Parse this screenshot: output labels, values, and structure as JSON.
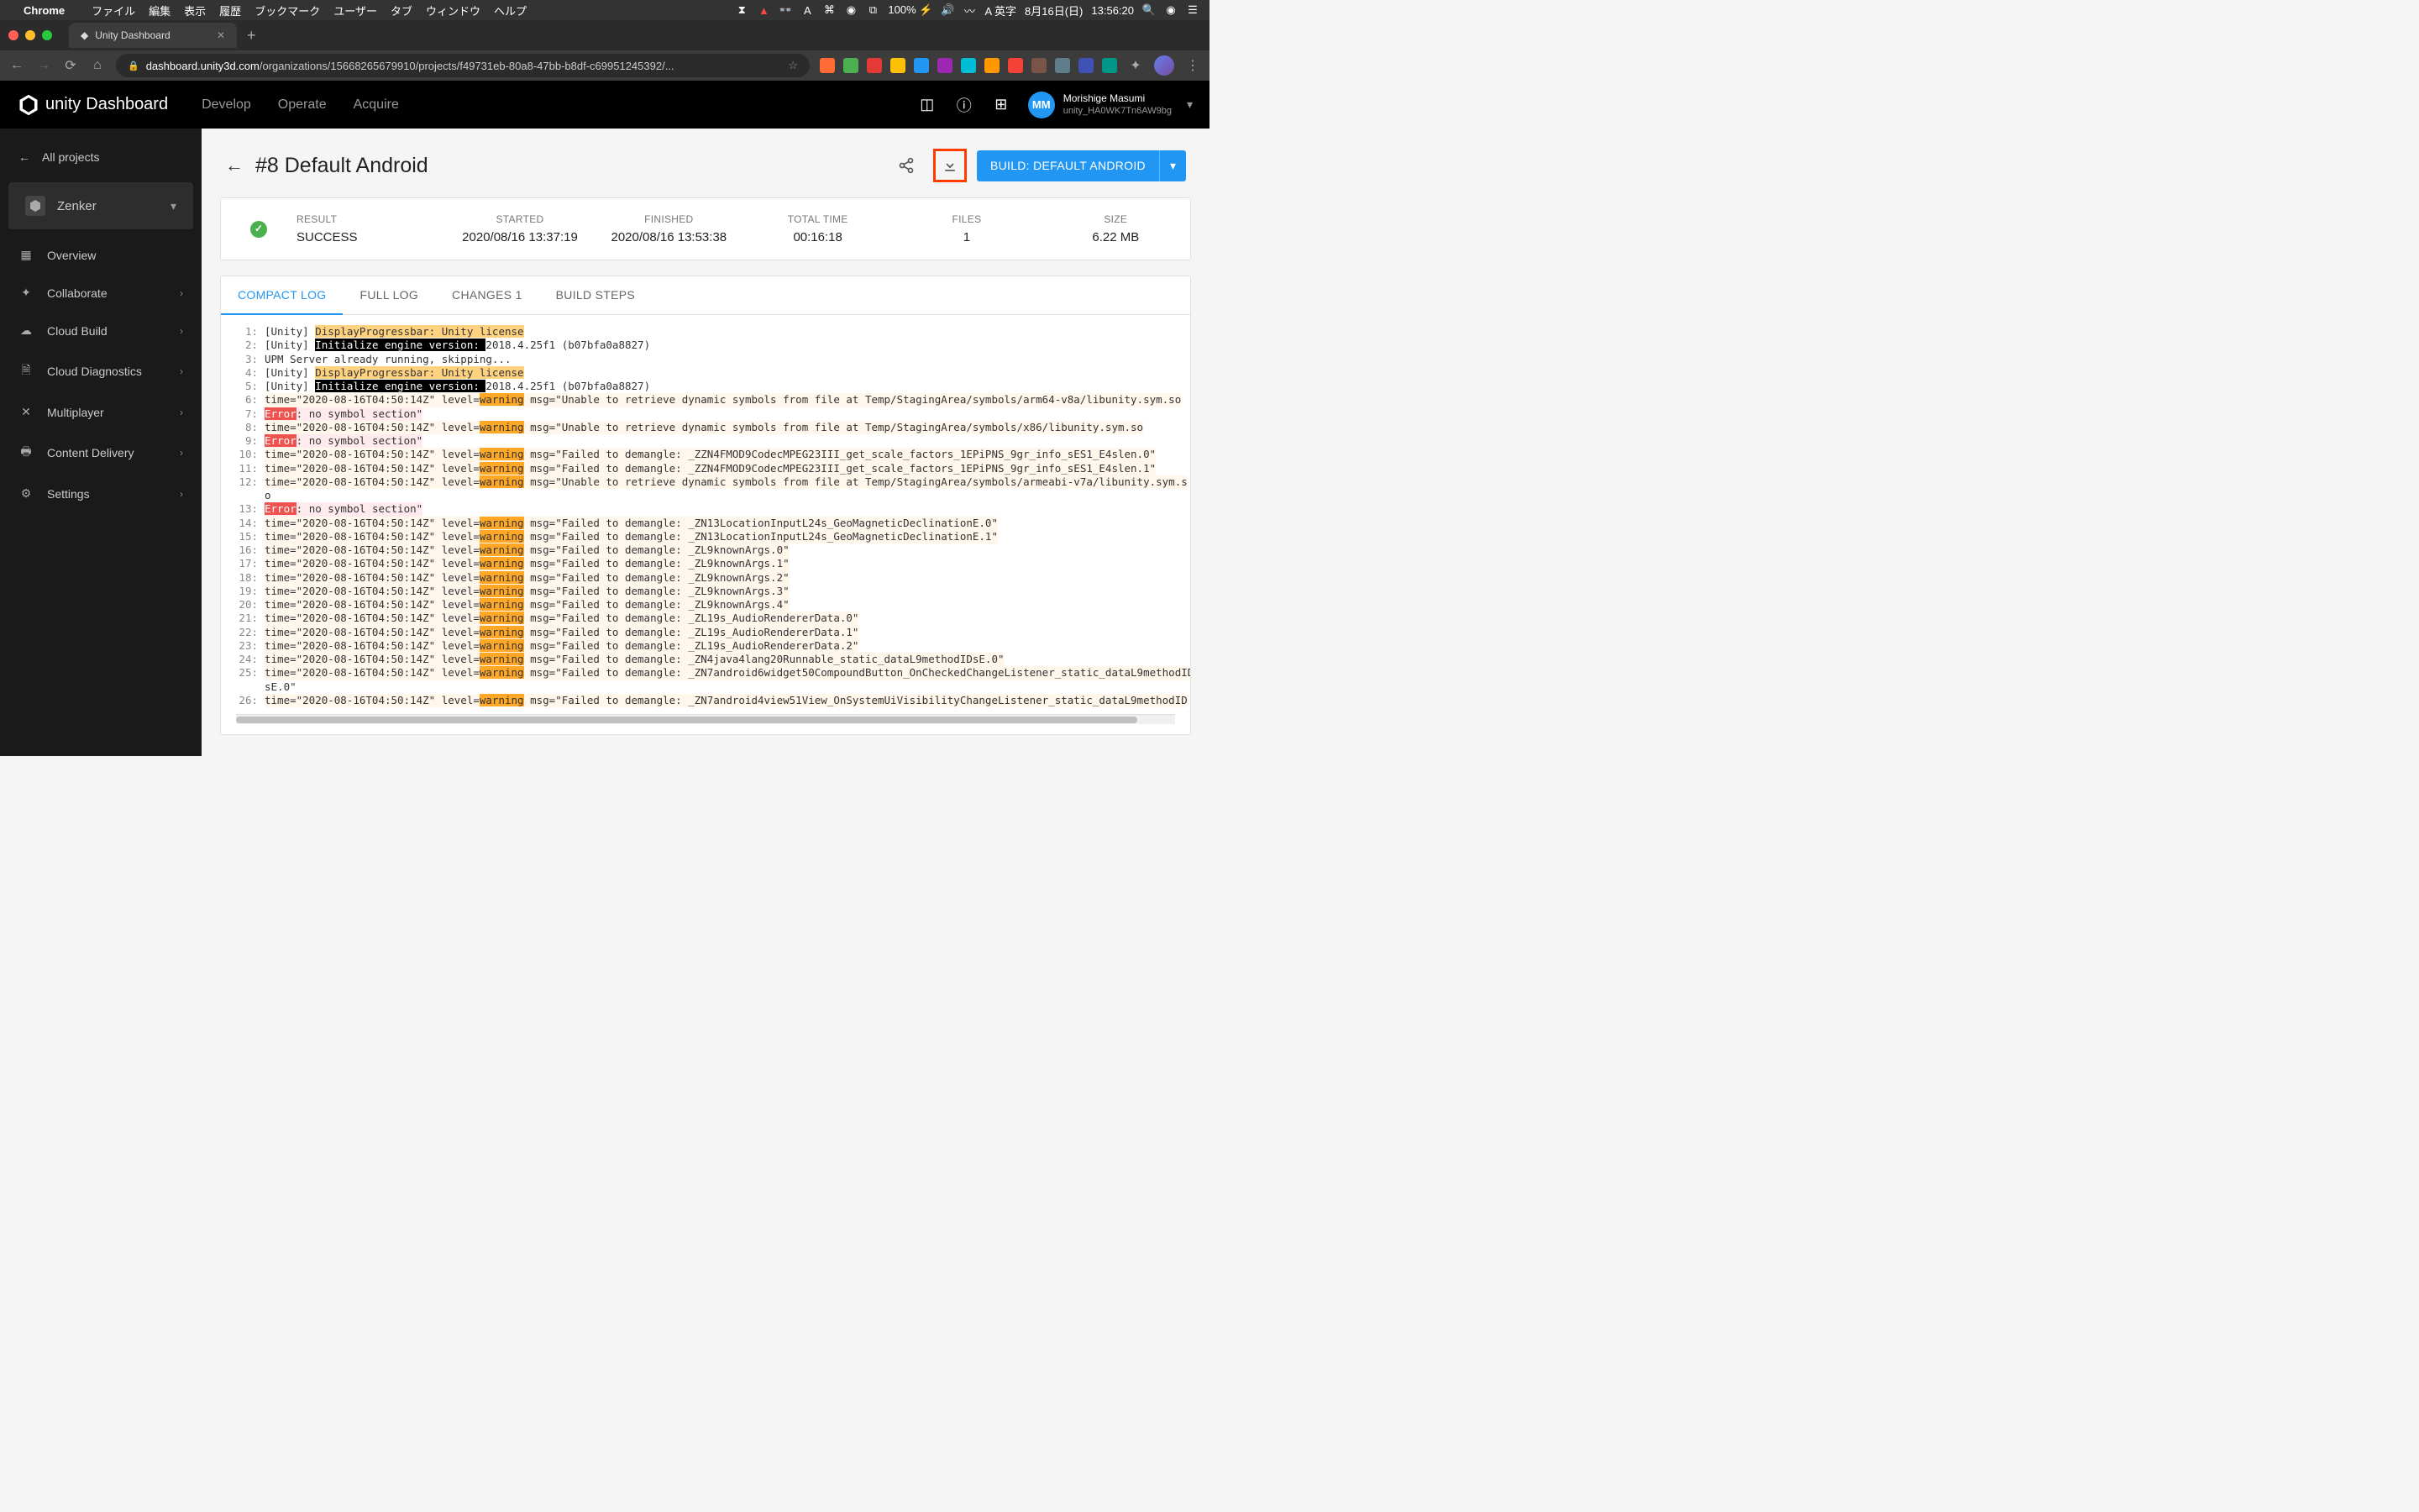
{
  "menubar": {
    "app": "Chrome",
    "items": [
      "ファイル",
      "編集",
      "表示",
      "履歴",
      "ブックマーク",
      "ユーザー",
      "タブ",
      "ウィンドウ",
      "ヘルプ"
    ],
    "battery": "100%",
    "ime": "英字",
    "date": "8月16日(日)",
    "time": "13:56:20"
  },
  "browser": {
    "tab_title": "Unity Dashboard",
    "url_host": "dashboard.unity3d.com",
    "url_path": "/organizations/15668265679910/projects/f49731eb-80a8-47bb-b8df-c69951245392/..."
  },
  "header": {
    "brand": "Dashboard",
    "nav": {
      "develop": "Develop",
      "operate": "Operate",
      "acquire": "Acquire"
    },
    "user": {
      "initials": "MM",
      "name": "Morishige Masumi",
      "org": "unity_HA0WK7Tn6AW9bg"
    }
  },
  "sidebar": {
    "back": "All projects",
    "project": "Zenker",
    "items": [
      {
        "icon": "▦",
        "label": "Overview",
        "chevron": false
      },
      {
        "icon": "✦",
        "label": "Collaborate",
        "chevron": true
      },
      {
        "icon": "☁",
        "label": "Cloud Build",
        "chevron": true
      },
      {
        "icon": "🗎",
        "label": "Cloud Diagnostics",
        "chevron": true
      },
      {
        "icon": "✕",
        "label": "Multiplayer",
        "chevron": true
      },
      {
        "icon": "🖶",
        "label": "Content Delivery",
        "chevron": true
      },
      {
        "icon": "⚙",
        "label": "Settings",
        "chevron": true
      }
    ]
  },
  "page": {
    "title": "#8 Default Android",
    "build_button": "BUILD: DEFAULT ANDROID"
  },
  "summary": {
    "labels": {
      "result": "RESULT",
      "started": "STARTED",
      "finished": "FINISHED",
      "total_time": "TOTAL TIME",
      "files": "FILES",
      "size": "SIZE"
    },
    "values": {
      "result": "SUCCESS",
      "started": "2020/08/16 13:37:19",
      "finished": "2020/08/16 13:53:38",
      "total_time": "00:16:18",
      "files": "1",
      "size": "6.22 MB"
    }
  },
  "log_tabs": {
    "compact": "COMPACT LOG",
    "full": "FULL LOG",
    "changes": "CHANGES 1",
    "steps": "BUILD STEPS"
  },
  "log": [
    {
      "n": "1",
      "segs": [
        {
          "t": " [Unity] "
        },
        {
          "t": "DisplayProgressbar: Unity license",
          "c": "hl-progress"
        }
      ]
    },
    {
      "n": "2",
      "segs": [
        {
          "t": " [Unity] "
        },
        {
          "t": "Initialize engine version: ",
          "c": "hl-init"
        },
        {
          "t": "2018.4.25f1 (b07bfa0a8827)"
        }
      ]
    },
    {
      "n": "3",
      "segs": [
        {
          "t": " UPM Server already running, skipping..."
        }
      ]
    },
    {
      "n": "4",
      "segs": [
        {
          "t": " [Unity] "
        },
        {
          "t": "DisplayProgressbar: Unity license",
          "c": "hl-progress"
        }
      ]
    },
    {
      "n": "5",
      "segs": [
        {
          "t": " [Unity] "
        },
        {
          "t": "Initialize engine version: ",
          "c": "hl-init"
        },
        {
          "t": "2018.4.25f1 (b07bfa0a8827)"
        }
      ]
    },
    {
      "n": "6",
      "bg": "hl-warnbg",
      "segs": [
        {
          "t": " time=\"2020-08-16T04:50:14Z\" level="
        },
        {
          "t": "warning",
          "c": "hl-warn"
        },
        {
          "t": " msg=\"Unable to retrieve dynamic symbols from file at Temp/StagingArea/symbols/arm64-v8a/libunity.sym.so"
        }
      ]
    },
    {
      "n": "7",
      "bg": "hl-errbg",
      "segs": [
        {
          "t": " "
        },
        {
          "t": "Error",
          "c": "hl-err"
        },
        {
          "t": ": no symbol section\""
        }
      ]
    },
    {
      "n": "8",
      "bg": "hl-warnbg",
      "segs": [
        {
          "t": " time=\"2020-08-16T04:50:14Z\" level="
        },
        {
          "t": "warning",
          "c": "hl-warn"
        },
        {
          "t": " msg=\"Unable to retrieve dynamic symbols from file at Temp/StagingArea/symbols/x86/libunity.sym.so"
        }
      ]
    },
    {
      "n": "9",
      "bg": "hl-errbg",
      "segs": [
        {
          "t": " "
        },
        {
          "t": "Error",
          "c": "hl-err"
        },
        {
          "t": ": no symbol section\""
        }
      ]
    },
    {
      "n": "10",
      "bg": "hl-warnbg",
      "segs": [
        {
          "t": " time=\"2020-08-16T04:50:14Z\" level="
        },
        {
          "t": "warning",
          "c": "hl-warn"
        },
        {
          "t": " msg=\"Failed to demangle: _ZZN4FMOD9CodecMPEG23III_get_scale_factors_1EPiPNS_9gr_info_sES1_E4slen.0\""
        }
      ]
    },
    {
      "n": "11",
      "bg": "hl-warnbg",
      "segs": [
        {
          "t": " time=\"2020-08-16T04:50:14Z\" level="
        },
        {
          "t": "warning",
          "c": "hl-warn"
        },
        {
          "t": " msg=\"Failed to demangle: _ZZN4FMOD9CodecMPEG23III_get_scale_factors_1EPiPNS_9gr_info_sES1_E4slen.1\""
        }
      ]
    },
    {
      "n": "12",
      "bg": "hl-warnbg",
      "segs": [
        {
          "t": " time=\"2020-08-16T04:50:14Z\" level="
        },
        {
          "t": "warning",
          "c": "hl-warn"
        },
        {
          "t": " msg=\"Unable to retrieve dynamic symbols from file at Temp/StagingArea/symbols/armeabi-v7a/libunity.sym.s"
        }
      ]
    },
    {
      "n": "",
      "segs": [
        {
          "t": "o"
        }
      ]
    },
    {
      "n": "13",
      "bg": "hl-errbg",
      "segs": [
        {
          "t": " "
        },
        {
          "t": "Error",
          "c": "hl-err"
        },
        {
          "t": ": no symbol section\""
        }
      ]
    },
    {
      "n": "14",
      "bg": "hl-warnbg",
      "segs": [
        {
          "t": " time=\"2020-08-16T04:50:14Z\" level="
        },
        {
          "t": "warning",
          "c": "hl-warn"
        },
        {
          "t": " msg=\"Failed to demangle: _ZN13LocationInputL24s_GeoMagneticDeclinationE.0\""
        }
      ]
    },
    {
      "n": "15",
      "bg": "hl-warnbg",
      "segs": [
        {
          "t": " time=\"2020-08-16T04:50:14Z\" level="
        },
        {
          "t": "warning",
          "c": "hl-warn"
        },
        {
          "t": " msg=\"Failed to demangle: _ZN13LocationInputL24s_GeoMagneticDeclinationE.1\""
        }
      ]
    },
    {
      "n": "16",
      "bg": "hl-warnbg",
      "segs": [
        {
          "t": " time=\"2020-08-16T04:50:14Z\" level="
        },
        {
          "t": "warning",
          "c": "hl-warn"
        },
        {
          "t": " msg=\"Failed to demangle: _ZL9knownArgs.0\""
        }
      ]
    },
    {
      "n": "17",
      "bg": "hl-warnbg",
      "segs": [
        {
          "t": " time=\"2020-08-16T04:50:14Z\" level="
        },
        {
          "t": "warning",
          "c": "hl-warn"
        },
        {
          "t": " msg=\"Failed to demangle: _ZL9knownArgs.1\""
        }
      ]
    },
    {
      "n": "18",
      "bg": "hl-warnbg",
      "segs": [
        {
          "t": " time=\"2020-08-16T04:50:14Z\" level="
        },
        {
          "t": "warning",
          "c": "hl-warn"
        },
        {
          "t": " msg=\"Failed to demangle: _ZL9knownArgs.2\""
        }
      ]
    },
    {
      "n": "19",
      "bg": "hl-warnbg",
      "segs": [
        {
          "t": " time=\"2020-08-16T04:50:14Z\" level="
        },
        {
          "t": "warning",
          "c": "hl-warn"
        },
        {
          "t": " msg=\"Failed to demangle: _ZL9knownArgs.3\""
        }
      ]
    },
    {
      "n": "20",
      "bg": "hl-warnbg",
      "segs": [
        {
          "t": " time=\"2020-08-16T04:50:14Z\" level="
        },
        {
          "t": "warning",
          "c": "hl-warn"
        },
        {
          "t": " msg=\"Failed to demangle: _ZL9knownArgs.4\""
        }
      ]
    },
    {
      "n": "21",
      "bg": "hl-warnbg",
      "segs": [
        {
          "t": " time=\"2020-08-16T04:50:14Z\" level="
        },
        {
          "t": "warning",
          "c": "hl-warn"
        },
        {
          "t": " msg=\"Failed to demangle: _ZL19s_AudioRendererData.0\""
        }
      ]
    },
    {
      "n": "22",
      "bg": "hl-warnbg",
      "segs": [
        {
          "t": " time=\"2020-08-16T04:50:14Z\" level="
        },
        {
          "t": "warning",
          "c": "hl-warn"
        },
        {
          "t": " msg=\"Failed to demangle: _ZL19s_AudioRendererData.1\""
        }
      ]
    },
    {
      "n": "23",
      "bg": "hl-warnbg",
      "segs": [
        {
          "t": " time=\"2020-08-16T04:50:14Z\" level="
        },
        {
          "t": "warning",
          "c": "hl-warn"
        },
        {
          "t": " msg=\"Failed to demangle: _ZL19s_AudioRendererData.2\""
        }
      ]
    },
    {
      "n": "24",
      "bg": "hl-warnbg",
      "segs": [
        {
          "t": " time=\"2020-08-16T04:50:14Z\" level="
        },
        {
          "t": "warning",
          "c": "hl-warn"
        },
        {
          "t": " msg=\"Failed to demangle: _ZN4java4lang20Runnable_static_dataL9methodIDsE.0\""
        }
      ]
    },
    {
      "n": "25",
      "bg": "hl-warnbg",
      "segs": [
        {
          "t": " time=\"2020-08-16T04:50:14Z\" level="
        },
        {
          "t": "warning",
          "c": "hl-warn"
        },
        {
          "t": " msg=\"Failed to demangle: _ZN7android6widget50CompoundButton_OnCheckedChangeListener_static_dataL9methodID"
        }
      ]
    },
    {
      "n": "",
      "segs": [
        {
          "t": "sE.0\""
        }
      ]
    },
    {
      "n": "26",
      "bg": "hl-warnbg",
      "segs": [
        {
          "t": " time=\"2020-08-16T04:50:14Z\" level="
        },
        {
          "t": "warning",
          "c": "hl-warn"
        },
        {
          "t": " msg=\"Failed to demangle: _ZN7android4view51View_OnSystemUiVisibilityChangeListener_static_dataL9methodID"
        }
      ]
    }
  ],
  "ext_colors": [
    "#ff6b35",
    "#4caf50",
    "#e53935",
    "#ffc107",
    "#2196f3",
    "#9c27b0",
    "#00bcd4",
    "#ff9800",
    "#f44336",
    "#795548",
    "#607d8b",
    "#3f51b5",
    "#009688"
  ]
}
